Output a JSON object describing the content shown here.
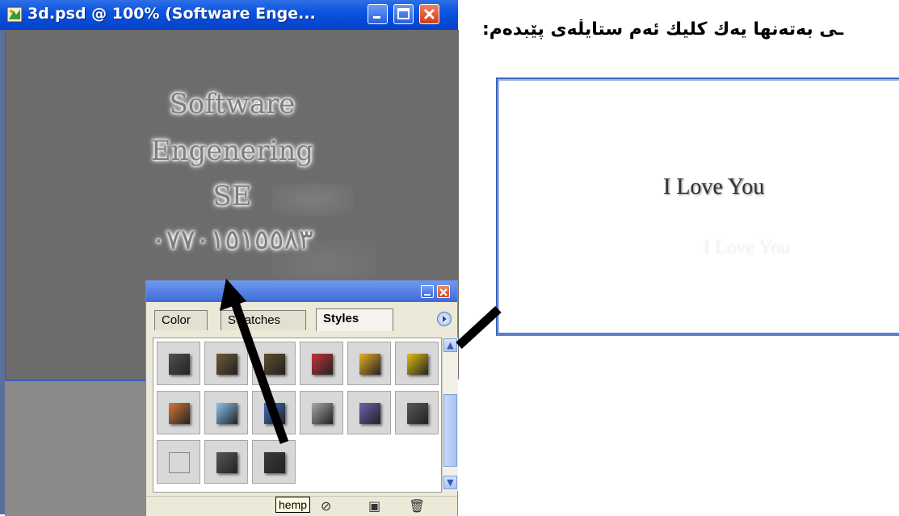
{
  "document_window": {
    "title": "3d.psd @ 100% (Software Enge...",
    "icon": "photoshop-document-icon"
  },
  "canvas_text": {
    "line1": "Software",
    "line2": "Engenering",
    "line3": "SE",
    "line4": "٠٧٧٠١٥١٥٥٨٣"
  },
  "styles_panel": {
    "tabs": [
      "Color",
      "Swatches",
      "Styles"
    ],
    "active_tab": "Styles",
    "tooltip": "hemp",
    "swatches": [
      [
        "#505050",
        "#6f5b37",
        "#5e4d2c",
        "#c4343c",
        "#e8b020",
        "#e0c010"
      ],
      [
        "#d87838",
        "#8bc3f0",
        "#3b70c0",
        "#a8a8a8",
        "#7060b0",
        "#585858"
      ],
      [
        "#d8d8d8",
        "#585858",
        "#3a3a3a"
      ]
    ]
  },
  "caption": {
    "text": "ـی بەتەنها یەك كلیك ئەم ستایڵەی پێبدەم:"
  },
  "preview": {
    "text": "I Love You",
    "shadow_text": "I Love You"
  },
  "colors": {
    "titlebar": "#0a55e0",
    "canvas": "#6c6c6c",
    "panel_bg": "#ece9d8"
  }
}
